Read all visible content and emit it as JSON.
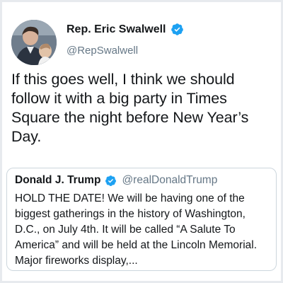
{
  "tweet": {
    "display_name": "Rep. Eric Swalwell",
    "handle": "@RepSwalwell",
    "text": "If this goes well, I think we should follow it with a big party in Times Square the night before New Year’s Day.",
    "avatar_icon": "profile-photo",
    "verified_icon": "verified-badge-icon"
  },
  "quoted_tweet": {
    "display_name": "Donald J. Trump",
    "handle": "@realDonaldTrump",
    "text": "HOLD THE DATE! We will be having one of the biggest gatherings in the history of Washington, D.C., on July 4th. It will be called “A Salute To America” and will be held at the Lincoln Memorial. Major fireworks display,...",
    "verified_icon": "verified-badge-icon"
  },
  "colors": {
    "verified_blue": "#1da1f2",
    "text_primary": "#14171a",
    "text_secondary": "#657786",
    "card_border": "#ccd6dd",
    "background_border": "#e7eaee"
  }
}
